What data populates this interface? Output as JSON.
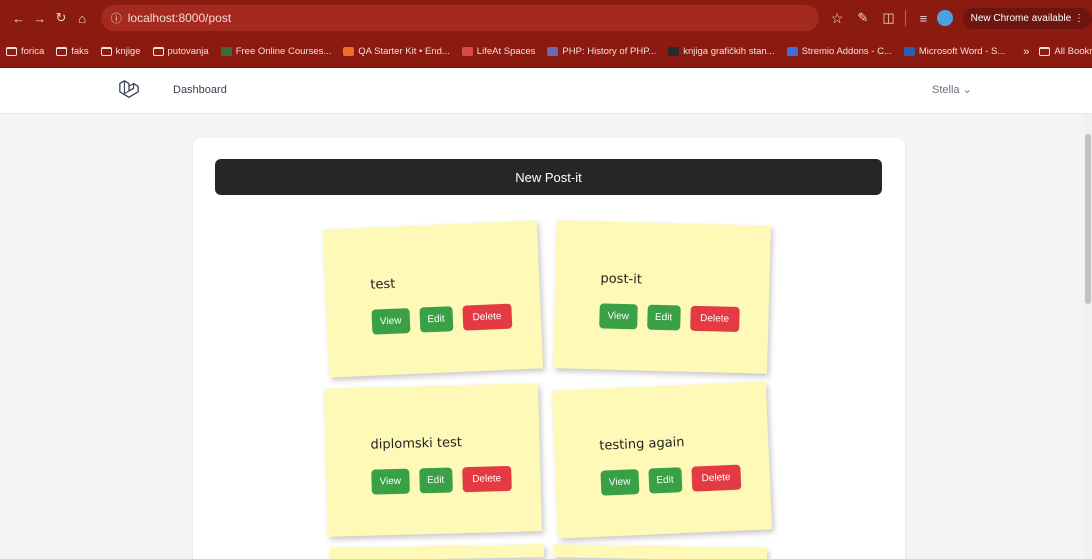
{
  "browser": {
    "url": "localhost:8000/post",
    "update_label": "New Chrome available",
    "bookmarks": [
      {
        "label": "forica",
        "type": "folder"
      },
      {
        "label": "faks",
        "type": "folder"
      },
      {
        "label": "knjige",
        "type": "folder"
      },
      {
        "label": "putovanja",
        "type": "folder"
      },
      {
        "label": "Free Online Courses...",
        "type": "site",
        "color": "#3b6b3b"
      },
      {
        "label": "QA Starter Kit • End...",
        "type": "site",
        "color": "#f26b2a"
      },
      {
        "label": "LifeAt Spaces",
        "type": "site",
        "color": "#d94b4b"
      },
      {
        "label": "PHP: History of PHP...",
        "type": "site",
        "color": "#6b6bb5"
      },
      {
        "label": "knjiga grafičkih stan...",
        "type": "site",
        "color": "#2a2a2a"
      },
      {
        "label": "Stremio Addons - C...",
        "type": "site",
        "color": "#3d6ed9"
      },
      {
        "label": "Microsoft Word - S...",
        "type": "site",
        "color": "#2b5fb0"
      }
    ],
    "all_bookmarks_label": "All Bookmarks"
  },
  "nav": {
    "dashboard_label": "Dashboard",
    "user_name": "Stella"
  },
  "main": {
    "new_post_label": "New Post-it"
  },
  "posts": [
    {
      "title": "test",
      "view_label": "View",
      "edit_label": "Edit",
      "delete_label": "Delete"
    },
    {
      "title": "post-it",
      "view_label": "View",
      "edit_label": "Edit",
      "delete_label": "Delete"
    },
    {
      "title": "diplomski test",
      "view_label": "View",
      "edit_label": "Edit",
      "delete_label": "Delete"
    },
    {
      "title": "testing again",
      "view_label": "View",
      "edit_label": "Edit",
      "delete_label": "Delete"
    }
  ],
  "colors": {
    "chrome": "#8b1a11",
    "note": "#fef9b7",
    "button_green": "#3aa046",
    "button_red": "#e33a44",
    "header_dark": "#262626"
  }
}
